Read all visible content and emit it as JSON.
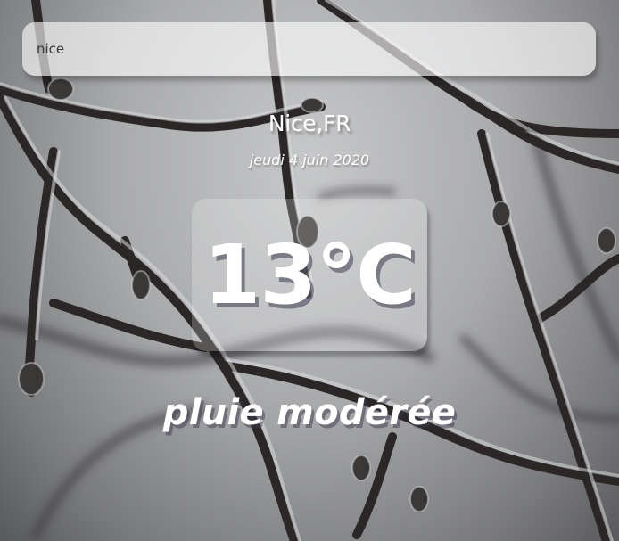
{
  "search": {
    "value": "nice"
  },
  "location": {
    "city": "Nice",
    "country": "FR",
    "label": "Nice,FR"
  },
  "date": "jeudi 4 juin 2020",
  "weather": {
    "temperature": "13°C",
    "description": "pluie modérée"
  }
}
